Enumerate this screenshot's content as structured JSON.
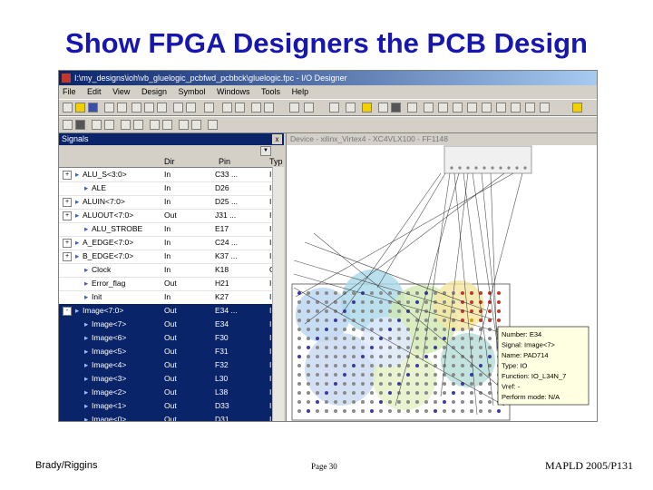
{
  "slide": {
    "title": "Show FPGA Designers the PCB Design",
    "footer_left": "Brady/Riggins",
    "footer_center": "Page 30",
    "footer_right": "MAPLD 2005/P131"
  },
  "window": {
    "title": "I:\\my_designs\\ioh\\vb_gluelogic_pcbfwd_pcbbck\\gluelogic.fpc - I/O Designer",
    "menus": [
      "File",
      "Edit",
      "View",
      "Design",
      "Symbol",
      "Windows",
      "Tools",
      "Help"
    ]
  },
  "signals_panel": {
    "title": "Signals",
    "close_label": "x",
    "columns": [
      "",
      "Dir",
      "Pin",
      "Typ"
    ],
    "rows": [
      {
        "expander": "+",
        "name": "ALU_S<3:0>",
        "dir": "In",
        "pin": "C33 ...",
        "typ": "I",
        "selected": false
      },
      {
        "expander": "",
        "name": "ALE",
        "dir": "In",
        "pin": "D26",
        "typ": "I",
        "selected": false
      },
      {
        "expander": "+",
        "name": "ALUIN<7:0>",
        "dir": "In",
        "pin": "D25 ...",
        "typ": "I",
        "selected": false
      },
      {
        "expander": "+",
        "name": "ALUOUT<7:0>",
        "dir": "Out",
        "pin": "J31 ...",
        "typ": "I",
        "selected": false
      },
      {
        "expander": "",
        "name": "ALU_STROBE",
        "dir": "In",
        "pin": "E17",
        "typ": "I",
        "selected": false
      },
      {
        "expander": "+",
        "name": "A_EDGE<7:0>",
        "dir": "In",
        "pin": "C24 ...",
        "typ": "I",
        "selected": false
      },
      {
        "expander": "+",
        "name": "B_EDGE<7:0>",
        "dir": "In",
        "pin": "K37 ...",
        "typ": "I",
        "selected": false
      },
      {
        "expander": "",
        "name": "Clock",
        "dir": "In",
        "pin": "K18",
        "typ": "C",
        "selected": false
      },
      {
        "expander": "",
        "name": "Error_flag",
        "dir": "Out",
        "pin": "H21",
        "typ": "I",
        "selected": false
      },
      {
        "expander": "",
        "name": "Init",
        "dir": "In",
        "pin": "K27",
        "typ": "I",
        "selected": false
      },
      {
        "expander": "-",
        "name": "Image<7:0>",
        "dir": "Out",
        "pin": "E34 ...",
        "typ": "I",
        "selected": true
      },
      {
        "expander": "",
        "name": "Image<7>",
        "dir": "Out",
        "pin": "E34",
        "typ": "I",
        "selected": true
      },
      {
        "expander": "",
        "name": "Image<6>",
        "dir": "Out",
        "pin": "F30",
        "typ": "I",
        "selected": true
      },
      {
        "expander": "",
        "name": "Image<5>",
        "dir": "Out",
        "pin": "F31",
        "typ": "I",
        "selected": true
      },
      {
        "expander": "",
        "name": "Image<4>",
        "dir": "Out",
        "pin": "F32",
        "typ": "I",
        "selected": true
      },
      {
        "expander": "",
        "name": "Image<3>",
        "dir": "Out",
        "pin": "L30",
        "typ": "I",
        "selected": true
      },
      {
        "expander": "",
        "name": "Image<2>",
        "dir": "Out",
        "pin": "L38",
        "typ": "I",
        "selected": true
      },
      {
        "expander": "",
        "name": "Image<1>",
        "dir": "Out",
        "pin": "D33",
        "typ": "I",
        "selected": true
      },
      {
        "expander": "",
        "name": "Image<0>",
        "dir": "Out",
        "pin": "D31",
        "typ": "I",
        "selected": true
      }
    ]
  },
  "device_view": {
    "title": "Device - xilinx_Virtex4 - XC4VLX100 - FF1148",
    "tooltip": {
      "lines": [
        "Number: E34",
        "Signal: Image<7>",
        "Name: PAD714",
        "Type: IO",
        "Function: IO_L34N_7",
        "Vref: -",
        "Perform mode: N/A"
      ]
    }
  },
  "colors": {
    "title_blue": "#1717b0",
    "selection": "#0a246a",
    "window_face": "#d4d0c8"
  }
}
